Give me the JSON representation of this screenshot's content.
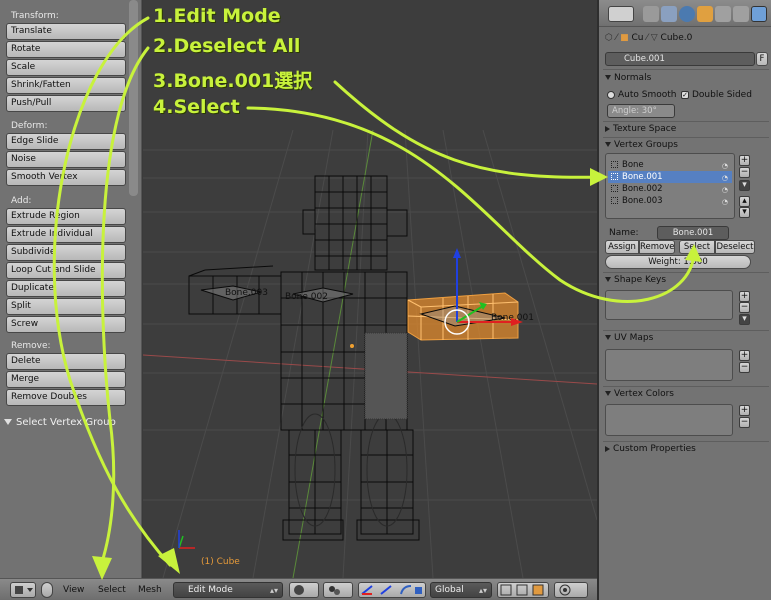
{
  "toolshelf": {
    "transform": {
      "title": "Transform:",
      "buttons": [
        "Translate",
        "Rotate",
        "Scale",
        "Shrink/Fatten",
        "Push/Pull"
      ]
    },
    "deform": {
      "title": "Deform:",
      "buttons": [
        "Edge Slide",
        "Noise",
        "Smooth Vertex"
      ]
    },
    "add": {
      "title": "Add:",
      "buttons": [
        "Extrude Region",
        "Extrude Individual",
        "Subdivide",
        "Loop Cut and Slide",
        "Duplicate",
        "Split",
        "Screw"
      ]
    },
    "remove": {
      "title": "Remove:",
      "buttons": [
        "Delete",
        "Merge",
        "Remove Doubles"
      ]
    },
    "operator_panel": "Select Vertex Group"
  },
  "viewport": {
    "object_label": "(1) Cube",
    "bone_labels": [
      "Bone.003",
      "Bone.001",
      "Bone.002"
    ]
  },
  "header3d": {
    "menus": [
      "View",
      "Select",
      "Mesh"
    ],
    "mode": "Edit Mode",
    "orientation": "Global"
  },
  "properties": {
    "breadcrumb": {
      "object": "Cu",
      "mesh": "Cube.0"
    },
    "mesh_name": "Cube.001",
    "mesh_fake_user": "F",
    "normals": {
      "title": "Normals",
      "auto_smooth": "Auto Smooth",
      "double_sided": "Double Sided",
      "angle": "Angle: 30°"
    },
    "texture_space": "Texture Space",
    "vertex_groups": {
      "title": "Vertex Groups",
      "items": [
        "Bone",
        "Bone.001",
        "Bone.002",
        "Bone.003"
      ],
      "selected_index": 1,
      "name_label": "Name:",
      "name_value": "Bone.001",
      "buttons": {
        "assign": "Assign",
        "remove": "Remove",
        "select": "Select",
        "deselect": "Deselect"
      },
      "weight": "Weight: 1.000"
    },
    "shape_keys": "Shape Keys",
    "uv_maps": "UV Maps",
    "vertex_colors": "Vertex Colors",
    "custom_properties": "Custom Properties"
  },
  "annotations": {
    "color": "#c8f23c",
    "steps": [
      "1.Edit Mode",
      "2.Deselect All",
      "3.Bone.001選択",
      "4.Select"
    ]
  }
}
